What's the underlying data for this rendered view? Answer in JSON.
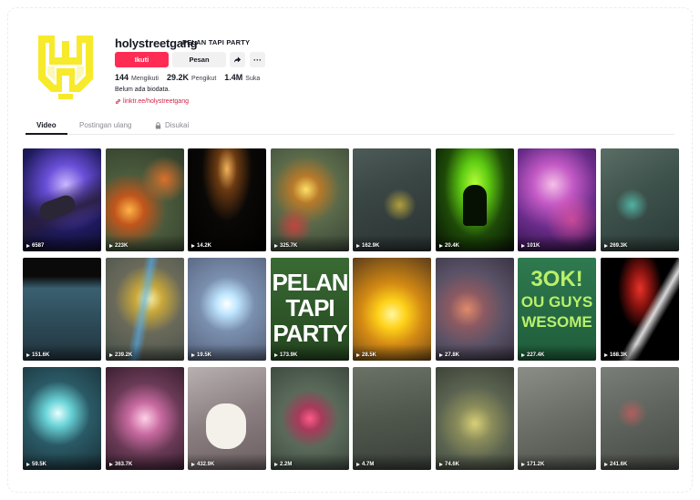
{
  "profile": {
    "username": "holystreetgang",
    "nickname": "PELAN TAPI PARTY",
    "follow_label": "Ikuti",
    "message_label": "Pesan",
    "more_label": "···",
    "following_count": "144",
    "following_label": "Mengikuti",
    "followers_count": "29.2K",
    "followers_label": "Pengikut",
    "likes_count": "1.4M",
    "likes_label": "Suka",
    "bio": "Belum ada biodata.",
    "link": "linktr.ee/holystreetgang",
    "avatar_color": "#f7ea2a"
  },
  "tabs": {
    "video": "Video",
    "repost": "Postingan ulang",
    "liked": "Disukai"
  },
  "videos": [
    {
      "views": "6587"
    },
    {
      "views": "223K"
    },
    {
      "views": "14.2K"
    },
    {
      "views": "325.7K"
    },
    {
      "views": "162.9K"
    },
    {
      "views": "20.4K"
    },
    {
      "views": "101K"
    },
    {
      "views": "269.3K"
    },
    {
      "views": "151.6K"
    },
    {
      "views": "239.2K"
    },
    {
      "views": "19.5K"
    },
    {
      "views": "173.9K"
    },
    {
      "views": "28.5K"
    },
    {
      "views": "27.8K"
    },
    {
      "views": "227.4K"
    },
    {
      "views": "168.3K"
    },
    {
      "views": "59.5K"
    },
    {
      "views": "363.7K"
    },
    {
      "views": "432.9K"
    },
    {
      "views": "2.2M"
    },
    {
      "views": "4.7M"
    },
    {
      "views": "74.6K"
    },
    {
      "views": "171.2K"
    },
    {
      "views": "241.6K"
    }
  ],
  "thumb_text": {
    "v12_line1": "PELAN",
    "v12_line2": "TAPI",
    "v12_line3": "PARTY",
    "v15_line1": "3OK!",
    "v15_line2": "OU GUYS",
    "v15_line3": "WESOME"
  },
  "colors": {
    "accent": "#fe2c55",
    "link": "#d1224a"
  }
}
